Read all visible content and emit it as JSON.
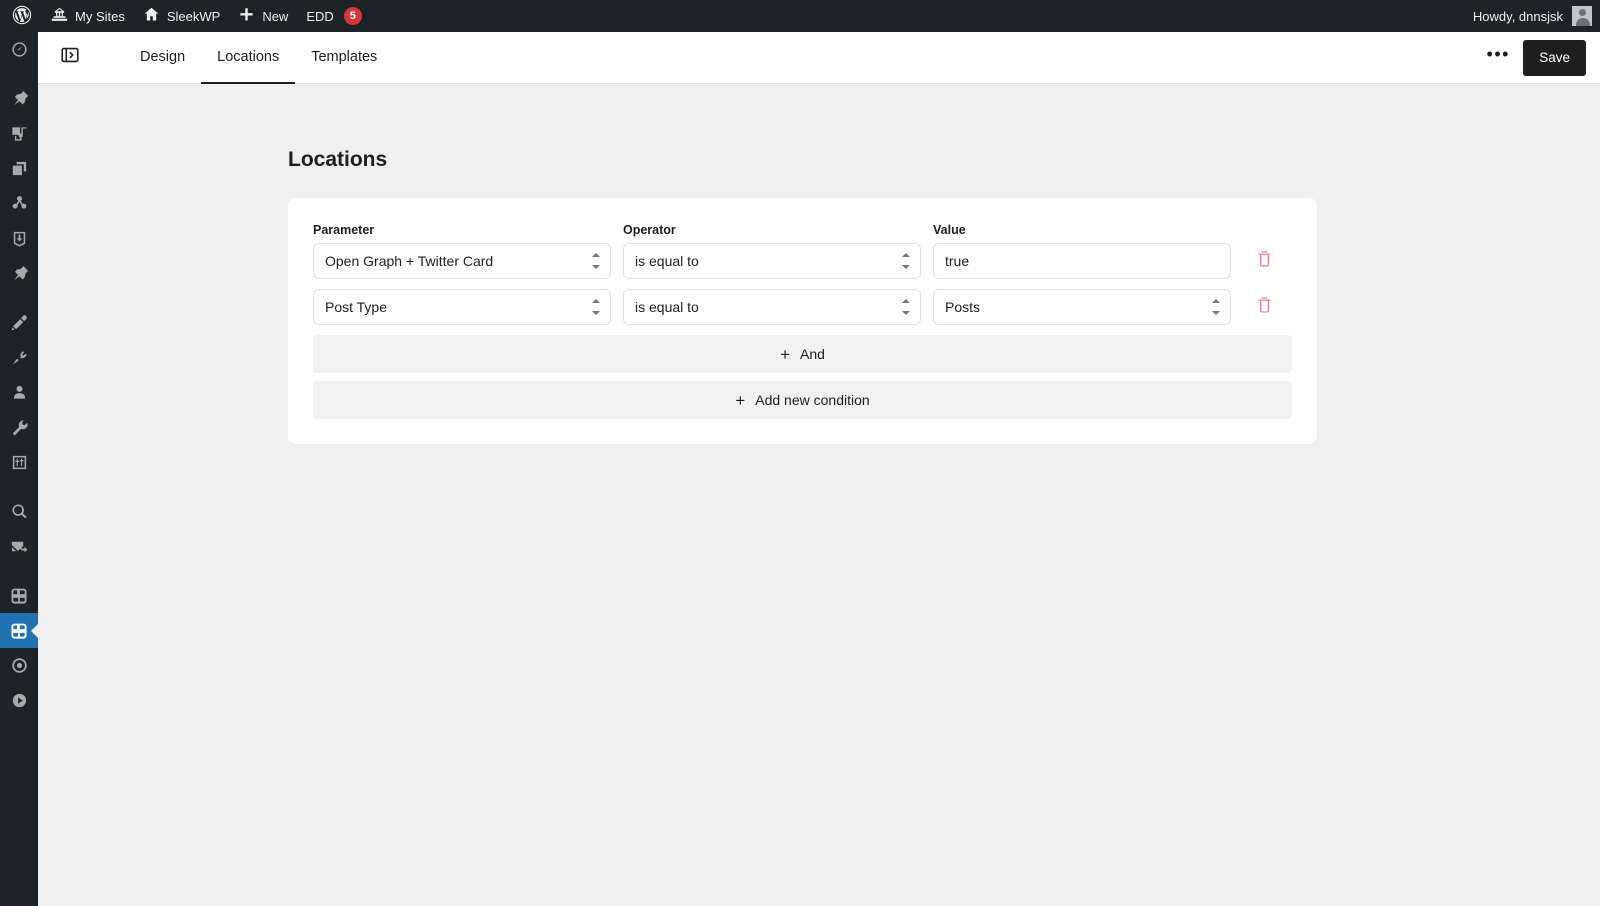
{
  "adminbar": {
    "logo_icon": "wordpress-logo-icon",
    "items": [
      {
        "icon": "sites-icon",
        "label": "My Sites",
        "name": "adminbar-my-sites"
      },
      {
        "icon": "home-icon",
        "label": "SleekWP",
        "name": "adminbar-site-name"
      },
      {
        "icon": "plus-icon",
        "label": "New",
        "name": "adminbar-new"
      },
      {
        "icon": "edd-icon",
        "label": "EDD",
        "badge": "5",
        "name": "adminbar-edd"
      }
    ],
    "howdy": "Howdy, dnnsjsk"
  },
  "sidebar": {
    "items": [
      {
        "icon": "dashboard-icon",
        "name": "sidebar-item-dashboard",
        "active": false
      },
      {
        "icon": "pin-icon",
        "name": "sidebar-item-posts",
        "active": false
      },
      {
        "icon": "media-icon",
        "name": "sidebar-item-media",
        "active": false
      },
      {
        "icon": "pages-icon",
        "name": "sidebar-item-pages",
        "active": false
      },
      {
        "icon": "share-icon",
        "name": "sidebar-item-share",
        "active": false
      },
      {
        "icon": "import-icon",
        "name": "sidebar-item-import",
        "active": false
      },
      {
        "icon": "pin-icon",
        "name": "sidebar-item-pinned",
        "active": false
      },
      {
        "icon": "brush-icon",
        "name": "sidebar-item-appearance",
        "active": false
      },
      {
        "icon": "plugin-icon",
        "name": "sidebar-item-plugins",
        "active": false
      },
      {
        "icon": "user-icon",
        "name": "sidebar-item-users",
        "active": false
      },
      {
        "icon": "wrench-icon",
        "name": "sidebar-item-tools",
        "active": false
      },
      {
        "icon": "sliders-icon",
        "name": "sidebar-item-settings",
        "active": false
      },
      {
        "icon": "search-icon",
        "name": "sidebar-item-search",
        "active": false
      },
      {
        "icon": "mail-icon",
        "name": "sidebar-item-mail",
        "active": false
      },
      {
        "icon": "blocks-icon",
        "name": "sidebar-item-blocks",
        "active": false
      },
      {
        "icon": "blocks-icon",
        "name": "sidebar-item-blockstudio",
        "active": true
      },
      {
        "icon": "circle-dot-icon",
        "name": "sidebar-item-circle",
        "active": false
      },
      {
        "icon": "play-icon",
        "name": "sidebar-item-play",
        "active": false
      }
    ]
  },
  "header": {
    "toggle_icon": "sidebar-toggle-icon",
    "tabs": [
      {
        "label": "Design",
        "active": false
      },
      {
        "label": "Locations",
        "active": true
      },
      {
        "label": "Templates",
        "active": false
      }
    ],
    "more_label": "•••",
    "save_label": "Save"
  },
  "main": {
    "title": "Locations",
    "columns": {
      "parameter": "Parameter",
      "operator": "Operator",
      "value": "Value"
    },
    "rows": [
      {
        "parameter": "Open Graph + Twitter Card",
        "parameter_type": "select",
        "operator": "is equal to",
        "operator_type": "select",
        "value": "true",
        "value_type": "text",
        "delete_icon": "trash-icon"
      },
      {
        "parameter": "Post Type",
        "parameter_type": "select",
        "operator": "is equal to",
        "operator_type": "select",
        "value": "Posts",
        "value_type": "select",
        "delete_icon": "trash-icon"
      }
    ],
    "and_label": "And",
    "add_condition_label": "Add new condition"
  },
  "colors": {
    "adminbar_bg": "#1d2327",
    "sidebar_bg": "#1d2327",
    "active_blue": "#2271b1",
    "badge_red": "#d63638",
    "trash_red": "#e8797b",
    "page_bg": "#f0f0f1",
    "card_bg": "#ffffff",
    "save_bg": "#1e1e1e"
  }
}
